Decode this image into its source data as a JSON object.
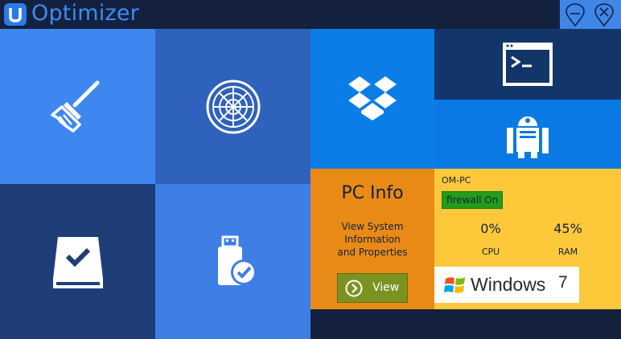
{
  "app": {
    "title": "Optimizer"
  },
  "window_controls": {
    "minimize_icon": "minimize-icon",
    "close_icon": "close-icon"
  },
  "tiles": {
    "cleaner": {
      "icon": "broom-icon"
    },
    "scanner": {
      "icon": "radar-icon"
    },
    "drive": {
      "icon": "drive-check-icon"
    },
    "usb": {
      "icon": "usb-check-icon"
    },
    "dropbox": {
      "icon": "dropbox-icon"
    },
    "terminal": {
      "icon": "terminal-icon"
    },
    "robot": {
      "icon": "robot-icon"
    }
  },
  "pc_info": {
    "title": "PC Info",
    "description": [
      "View System",
      "Information",
      "and Properties"
    ],
    "view_button": "View"
  },
  "system": {
    "hostname": "OM-PC",
    "firewall": "firewall On",
    "cpu_value": "0%",
    "cpu_label": "CPU",
    "ram_value": "45%",
    "ram_label": "RAM",
    "os_name": "Windows",
    "os_version": "7"
  },
  "colors": {
    "title_bar": "#13213f",
    "accent": "#3d8cf2",
    "pc_info_tile": "#e98a17",
    "system_tile": "#fdc93a",
    "view_button": "#7c9220",
    "firewall_badge": "#249c1a"
  }
}
